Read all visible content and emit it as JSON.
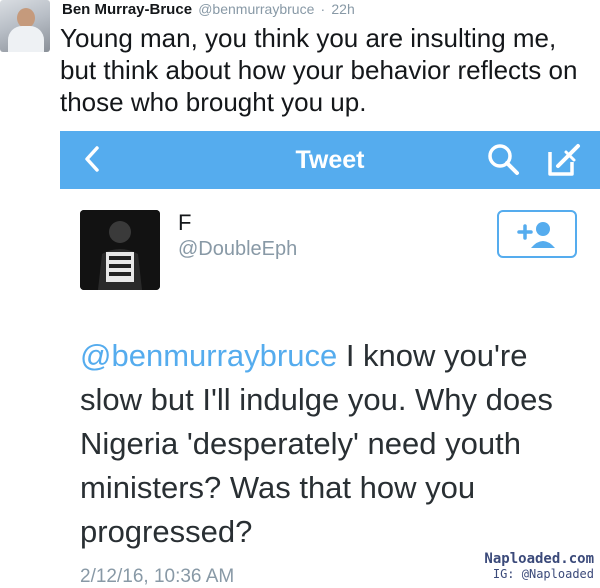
{
  "outer_tweet": {
    "name": "Ben Murray-Bruce",
    "handle": "@benmurraybruce",
    "separator": "·",
    "time": "22h",
    "text": "Young man, you think you are insulting me, but think about how your behavior reflects on those who brought you up."
  },
  "screenshot": {
    "nav": {
      "title": "Tweet",
      "back_icon": "chevron-left-icon",
      "search_icon": "search-icon",
      "compose_icon": "compose-icon"
    },
    "user": {
      "name": "F",
      "handle": "@DoubleEph",
      "follow_icon": "add-user-icon"
    },
    "tweet": {
      "mention": "@benmurraybruce",
      "text": " I know you're slow but I'll indulge you. Why does Nigeria 'desperately' need youth ministers? Was that how you progressed?",
      "date": "2/12/16, 10:36 AM"
    },
    "colors": {
      "accent": "#55acee",
      "muted": "#8899a6"
    }
  },
  "watermark": {
    "line1": "Naploaded.com",
    "line2": "IG: @Naploaded"
  }
}
